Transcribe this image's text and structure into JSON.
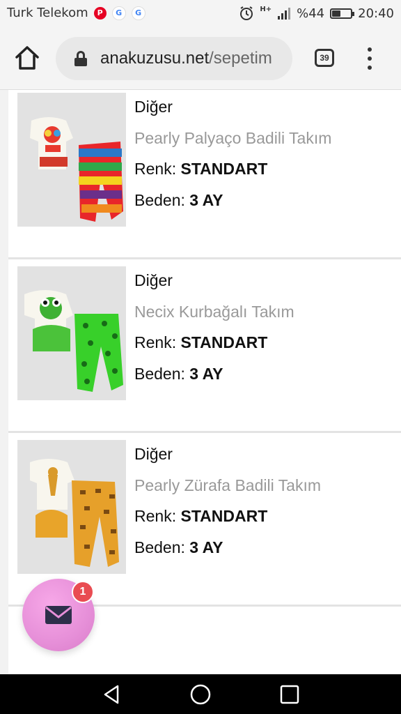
{
  "status_bar": {
    "carrier": "Turk Telekom",
    "notifications": [
      {
        "icon": "pinterest-icon",
        "glyph": "P"
      },
      {
        "icon": "google-icon",
        "glyph": "G"
      },
      {
        "icon": "google-icon",
        "glyph": "G"
      }
    ],
    "network": "H+",
    "battery_text": "%44",
    "battery_level": 0.44,
    "time": "20:40"
  },
  "browser": {
    "url_domain": "anakuzusu.net",
    "url_path": "/sepetim",
    "tab_count": "39"
  },
  "products": [
    {
      "category": "Diğer",
      "name": "Pearly Palyaço Badili Takım",
      "color_label": "Renk:",
      "color_value": "STANDART",
      "size_label": "Beden:",
      "size_value": "3 AY"
    },
    {
      "category": "Diğer",
      "name": "Necix Kurbağalı Takım",
      "color_label": "Renk:",
      "color_value": "STANDART",
      "size_label": "Beden:",
      "size_value": "3 AY"
    },
    {
      "category": "Diğer",
      "name": "Pearly Zürafa Badili Takım",
      "color_label": "Renk:",
      "color_value": "STANDART",
      "size_label": "Beden:",
      "size_value": "3 AY"
    }
  ],
  "fab": {
    "icon": "mail-icon",
    "badge_count": "1"
  },
  "nav": {
    "back_icon": "back-triangle-icon",
    "home_icon": "home-circle-icon",
    "recents_icon": "recents-square-icon"
  },
  "colors": {
    "accent_badge": "#e94c52",
    "fab_pink": "#e68fd8"
  }
}
